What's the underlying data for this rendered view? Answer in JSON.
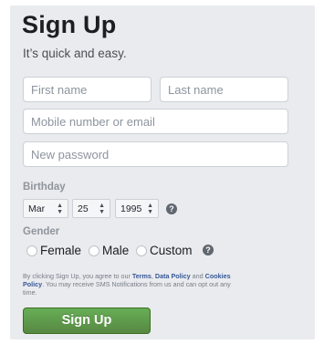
{
  "header": {
    "title": "Sign Up",
    "subtitle": "It’s quick and easy."
  },
  "form": {
    "first_name_placeholder": "First name",
    "last_name_placeholder": "Last name",
    "contact_placeholder": "Mobile number or email",
    "password_placeholder": "New password"
  },
  "birthday": {
    "label": "Birthday",
    "month": "Mar",
    "day": "25",
    "year": "1995",
    "help_icon": "question-icon"
  },
  "gender": {
    "label": "Gender",
    "options": [
      "Female",
      "Male",
      "Custom"
    ],
    "help_icon": "question-icon"
  },
  "terms": {
    "prefix": "By clicking Sign Up, you agree to our ",
    "terms_link": "Terms",
    "sep1": ", ",
    "data_policy_link": "Data Policy",
    "sep2": " and ",
    "cookies_link": "Cookies Policy",
    "suffix": ". You may receive SMS Notifications from us and can opt out any time."
  },
  "actions": {
    "signup_label": "Sign Up"
  },
  "colors": {
    "panel_background": "#e9ebee",
    "button_green": "#67ae55",
    "link_blue": "#385898"
  }
}
